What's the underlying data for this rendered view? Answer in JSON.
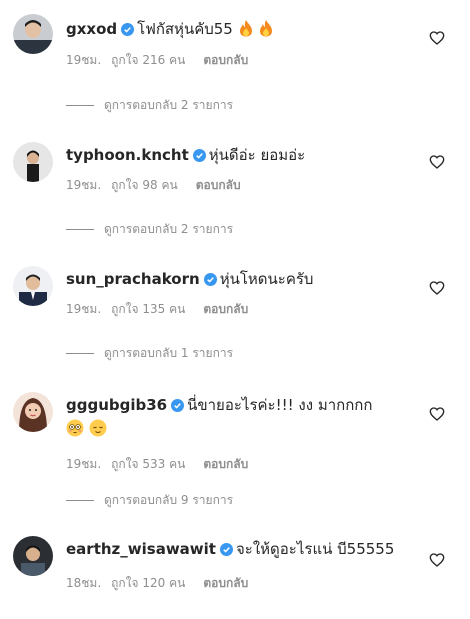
{
  "comments": [
    {
      "username": "gxxod",
      "text": "โฟกัสหุ่นคับ55",
      "emojis": [
        "fire-emoji",
        "fire-emoji"
      ],
      "time": "19ชม.",
      "likes": "ถูกใจ 216 คน",
      "reply_label": "ตอบกลับ",
      "view_replies": "ดูการตอบกลับ 2 รายการ"
    },
    {
      "username": "typhoon.kncht",
      "text": "หุ่นดีอ่ะ ยอมอ่ะ",
      "time": "19ชม.",
      "likes": "ถูกใจ 98 คน",
      "reply_label": "ตอบกลับ",
      "view_replies": "ดูการตอบกลับ 2 รายการ"
    },
    {
      "username": "sun_prachakorn",
      "text": "หุ่นโหดนะครับ",
      "time": "19ชม.",
      "likes": "ถูกใจ 135 คน",
      "reply_label": "ตอบกลับ",
      "view_replies": "ดูการตอบกลับ 1 รายการ"
    },
    {
      "username": "gggubgib36",
      "text": "นี่ขายอะไรค่ะ!!! งง มากกกก",
      "emojis": [
        "flushed-face-emoji",
        "relieved-face-emoji"
      ],
      "time": "19ชม.",
      "likes": "ถูกใจ 533 คน",
      "reply_label": "ตอบกลับ",
      "view_replies": "ดูการตอบกลับ 9 รายการ"
    },
    {
      "username": "earthz_wisawawit",
      "text": "จะให้ดูอะไรแน่ บี55555",
      "time": "18ชม.",
      "likes": "ถูกใจ 120 คน",
      "reply_label": "ตอบกลับ"
    }
  ],
  "colors": {
    "verified": "#3897f0",
    "secondary_text": "#8e8e8e",
    "primary_text": "#262626"
  }
}
